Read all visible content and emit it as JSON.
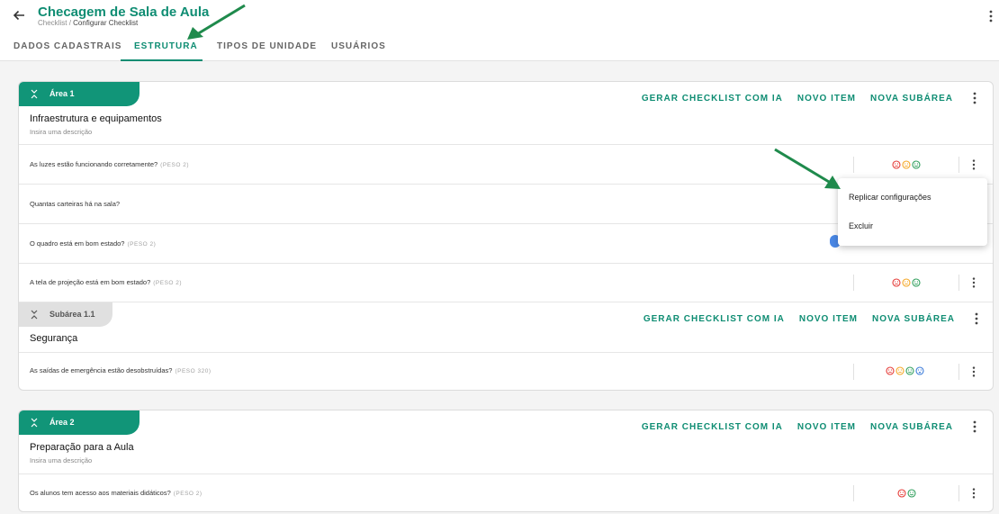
{
  "header": {
    "title": "Checagem de Sala de Aula",
    "breadcrumb_parent": "Checklist",
    "breadcrumb_sep": "/",
    "breadcrumb_current": "Configurar Checklist"
  },
  "tabs": [
    {
      "label": "DADOS CADASTRAIS",
      "active": false
    },
    {
      "label": "ESTRUTURA",
      "active": true
    },
    {
      "label": "TIPOS DE UNIDADE",
      "active": false
    },
    {
      "label": "USUÁRIOS",
      "active": false
    }
  ],
  "actions": {
    "generate": "GERAR CHECKLIST COM IA",
    "new_item": "NOVO ITEM",
    "new_subarea": "NOVA SUBÁREA"
  },
  "area1": {
    "label": "Área 1",
    "title": "Infraestrutura e equipamentos",
    "description": "Insira uma descrição",
    "items": [
      {
        "question": "As luzes estão funcionando corretamente?",
        "peso": "(PESO 2)"
      },
      {
        "question": "Quantas carteiras há na sala?",
        "peso": ""
      },
      {
        "question": "O quadro está em bom estado?",
        "peso": "(PESO 2)"
      },
      {
        "question": "A tela de projeção está em bom estado?",
        "peso": "(PESO 2)"
      }
    ],
    "subarea": {
      "label": "Subárea 1.1",
      "title": "Segurança",
      "items": [
        {
          "question": "As saídas de emergência estão desobstruídas?",
          "peso": "(PESO 320)"
        }
      ]
    }
  },
  "area2": {
    "label": "Área 2",
    "title": "Preparação para a Aula",
    "description": "Insira uma descrição",
    "items": [
      {
        "question": "Os alunos tem acesso aos materiais didáticos?",
        "peso": "(PESO 2)"
      }
    ]
  },
  "context_menu": {
    "items": [
      "Replicar configurações",
      "Excluir"
    ]
  },
  "colors": {
    "brand": "#0f8d73",
    "face_sad": "#e53935",
    "face_neutral": "#f5a623",
    "face_happy": "#2e9e5b",
    "face_extra": "#3b7bd9",
    "annotation_arrow": "#1f8a4c"
  }
}
